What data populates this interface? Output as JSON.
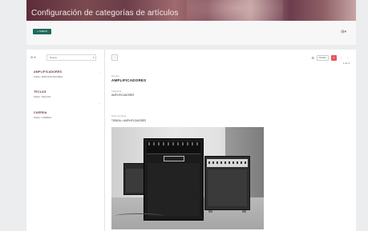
{
  "header": {
    "title": "Configuración de categorías de artículos",
    "right_text": "",
    "new_button_label": "+ NUEVO",
    "top_right_icon": "user-icon"
  },
  "sidebar": {
    "search_placeholder": "Buscar",
    "filter_label": "⊕ ▾",
    "categories": [
      {
        "name": "AMPLIFICADORES",
        "subtitle": "Padre: AMPLIFICADORES"
      },
      {
        "name": "TECLAS",
        "subtitle": "Padre: TECLAS"
      },
      {
        "name": "CUERDA",
        "subtitle": "Padre: CUERDA"
      }
    ]
  },
  "detail": {
    "back_label": "‹",
    "gear_label": "⚙",
    "action_label": "Acción",
    "pager_current": "1",
    "pager_count": "1 de 3",
    "name_label": "Nombre",
    "name_value": "AMPLIFICADORES",
    "description_label": "Categoría",
    "description_value": "AMPLIFICADORES",
    "path_label": "Ruta completa",
    "path_value": "TIENDA > AMPLIFICADORES",
    "image_alt": "amplifier-photo"
  }
}
